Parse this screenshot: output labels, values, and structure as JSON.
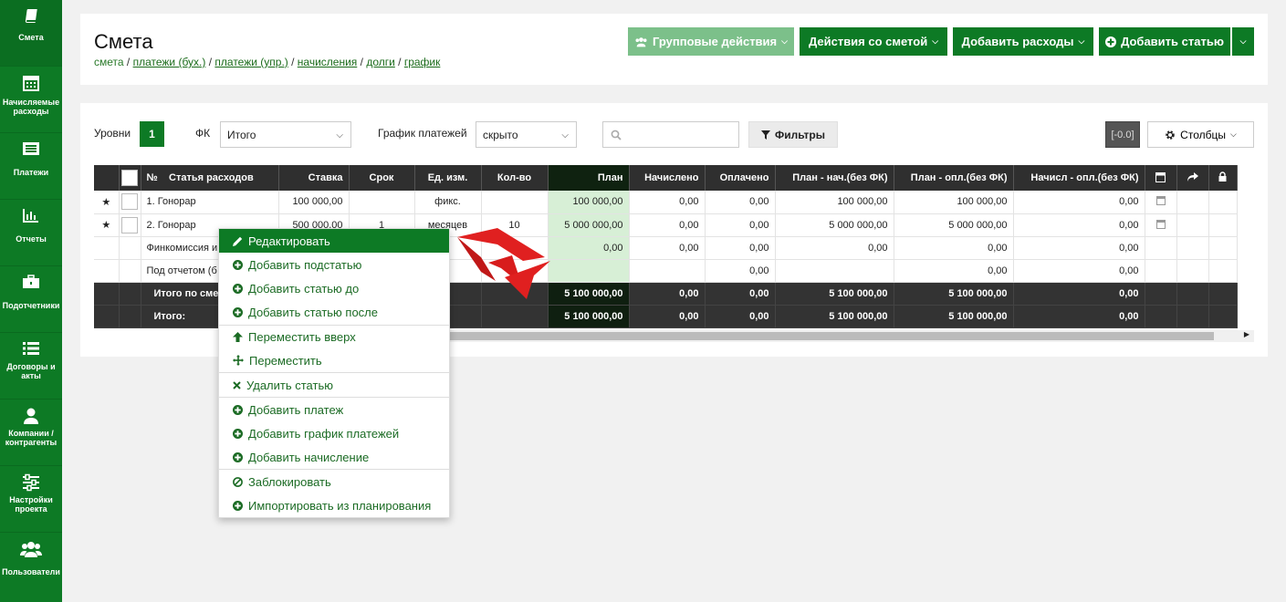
{
  "sidebar": {
    "items": [
      {
        "label": "Смета",
        "icon": "book-icon",
        "active": true
      },
      {
        "label": "Начисляемые расходы",
        "icon": "calendar-icon"
      },
      {
        "label": "Платежи",
        "icon": "list-card-icon"
      },
      {
        "label": "Отчеты",
        "icon": "bar-chart-icon"
      },
      {
        "label": "Подотчетники",
        "icon": "briefcase-icon"
      },
      {
        "label": "Договоры и акты",
        "icon": "list-icon"
      },
      {
        "label": "Компании / контрагенты",
        "icon": "user-icon"
      },
      {
        "label": "Настройки проекта",
        "icon": "sliders-icon"
      },
      {
        "label": "Пользователи",
        "icon": "users-icon"
      }
    ]
  },
  "header": {
    "title": "Смета",
    "breadcrumb": {
      "current": "смета",
      "links": [
        "платежи (бух.)",
        "платежи (упр.)",
        "начисления",
        "долги",
        "график"
      ]
    },
    "buttons": {
      "group": "Групповые действия",
      "estimate": "Действия со сметой",
      "add_expenses": "Добавить расходы",
      "add_item": "Добавить статью"
    }
  },
  "filters": {
    "levels_label": "Уровни",
    "levels_value": "1",
    "fk_label": "ФК",
    "fk_value": "Итого",
    "schedule_label": "График платежей",
    "schedule_value": "скрыто",
    "search_placeholder": "",
    "filters_btn": "Фильтры",
    "value_badge": "[-0.0]",
    "columns_btn": "Столбцы"
  },
  "table": {
    "headers": {
      "num": "№",
      "item": "Статья расходов",
      "rate": "Ставка",
      "term": "Срок",
      "unit": "Ед. изм.",
      "qty": "Кол-во",
      "plan": "План",
      "accrued": "Начислено",
      "paid": "Оплачено",
      "plan_acc": "План - нач.(без ФК)",
      "plan_paid": "План - опл.(без ФК)",
      "acc_paid": "Начисл - опл.(без ФК)"
    },
    "rows": [
      {
        "name": "1. Гонорар",
        "rate": "100 000,00",
        "term": "",
        "unit": "фикс.",
        "qty": "",
        "plan": "100 000,00",
        "accrued": "0,00",
        "paid": "0,00",
        "plan_acc": "100 000,00",
        "plan_paid": "100 000,00",
        "acc_paid": "0,00"
      },
      {
        "name": "2. Гонорар",
        "rate": "500 000,00",
        "term": "1",
        "unit": "месяцев",
        "qty": "10",
        "plan": "5 000 000,00",
        "accrued": "0,00",
        "paid": "0,00",
        "plan_acc": "5 000 000,00",
        "plan_paid": "5 000 000,00",
        "acc_paid": "0,00"
      },
      {
        "name": "Финкомиссия и",
        "rate": "",
        "term": "",
        "unit": "",
        "qty": "",
        "plan": "0,00",
        "accrued": "0,00",
        "paid": "0,00",
        "plan_acc": "0,00",
        "plan_paid": "0,00",
        "acc_paid": "0,00"
      },
      {
        "name": "Под отчетом (б",
        "rate": "",
        "term": "",
        "unit": "",
        "qty": "",
        "plan": "",
        "accrued": "",
        "paid": "0,00",
        "plan_acc": "",
        "plan_paid": "0,00",
        "acc_paid": "0,00"
      }
    ],
    "totals": [
      {
        "name": "Итого по сме",
        "plan": "5 100 000,00",
        "accrued": "0,00",
        "paid": "0,00",
        "plan_acc": "5 100 000,00",
        "plan_paid": "5 100 000,00",
        "acc_paid": "0,00"
      },
      {
        "name": "Итого:",
        "plan": "5 100 000,00",
        "accrued": "0,00",
        "paid": "0,00",
        "plan_acc": "5 100 000,00",
        "plan_paid": "5 100 000,00",
        "acc_paid": "0,00"
      }
    ]
  },
  "context_menu": {
    "items": [
      {
        "label": "Редактировать",
        "icon": "pencil-icon",
        "highlighted": true
      },
      {
        "label": "Добавить подстатью",
        "icon": "plus-circle-icon"
      },
      {
        "label": "Добавить статью до",
        "icon": "plus-circle-icon"
      },
      {
        "label": "Добавить статью после",
        "icon": "plus-circle-icon"
      },
      {
        "label": "Переместить вверх",
        "icon": "arrow-up-icon"
      },
      {
        "label": "Переместить",
        "icon": "move-icon"
      },
      {
        "label": "Удалить статью",
        "icon": "x-icon"
      },
      {
        "label": "Добавить платеж",
        "icon": "plus-circle-icon"
      },
      {
        "label": "Добавить график платежей",
        "icon": "plus-circle-icon"
      },
      {
        "label": "Добавить начисление",
        "icon": "plus-circle-icon"
      },
      {
        "label": "Заблокировать",
        "icon": "ban-icon"
      },
      {
        "label": "Импортировать из планирования",
        "icon": "plus-circle-icon"
      }
    ]
  },
  "colors": {
    "brand": "#0d7a25",
    "brand_light": "#7cc08a",
    "plan_cell": "#d7efd6",
    "header_dark": "#2f2f2f",
    "annotation_arrow": "#e02020"
  }
}
